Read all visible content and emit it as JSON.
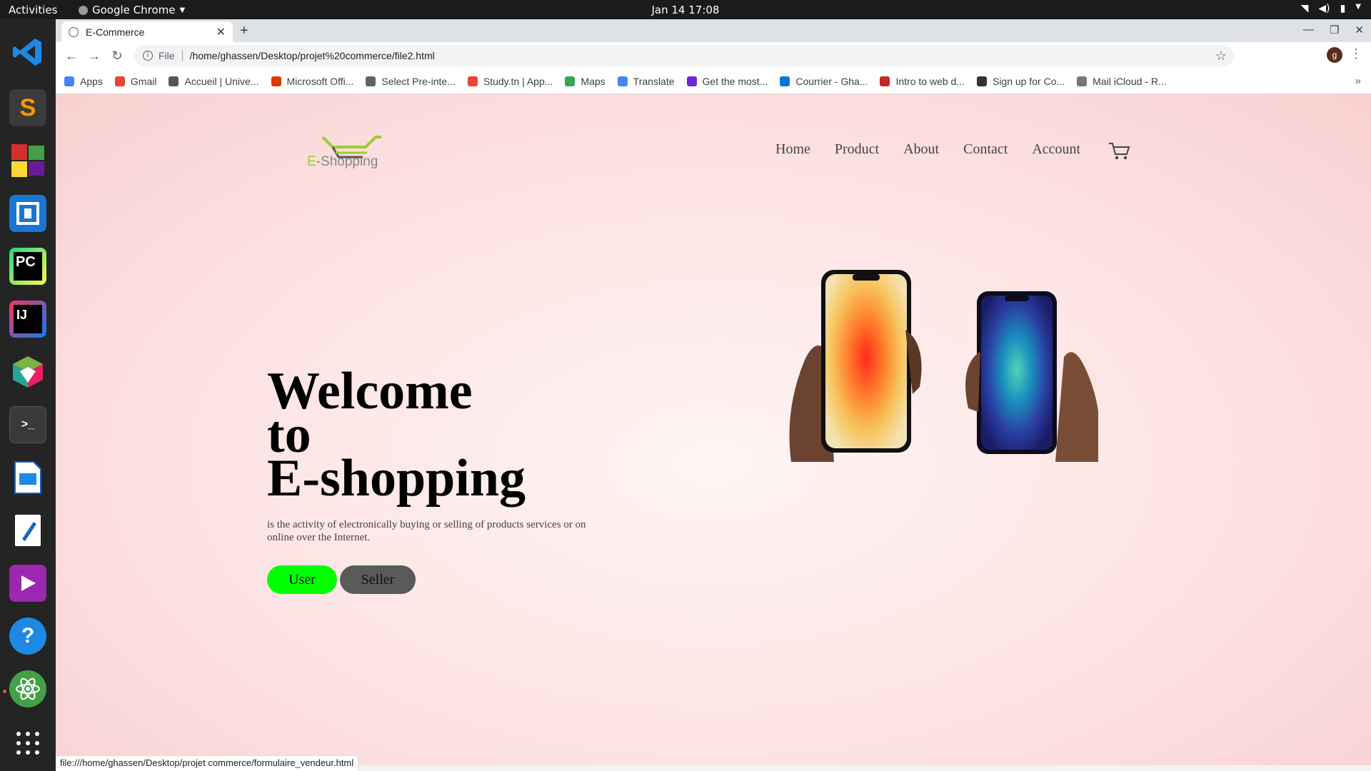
{
  "system": {
    "activities": "Activities",
    "app_name": "Google Chrome",
    "clock": "Jan 14  17:08"
  },
  "browser": {
    "tab_title": "E-Commerce",
    "url_scheme": "File",
    "url": "/home/ghassen/Desktop/projet%20commerce/file2.html",
    "profile_initial": "g",
    "bookmarks": [
      {
        "label": "Apps",
        "color": "#4285f4"
      },
      {
        "label": "Gmail",
        "color": "#ea4335"
      },
      {
        "label": "Accueil | Unive...",
        "color": "#555555"
      },
      {
        "label": "Microsoft Offi...",
        "color": "#d83b01"
      },
      {
        "label": "Select Pre-inte...",
        "color": "#5f6368"
      },
      {
        "label": "Study.tn | App...",
        "color": "#ea4335"
      },
      {
        "label": "Maps",
        "color": "#34a853"
      },
      {
        "label": "Translate",
        "color": "#4285f4"
      },
      {
        "label": "Get the most...",
        "color": "#6c2bd9"
      },
      {
        "label": "Courrier - Gha...",
        "color": "#0078d4"
      },
      {
        "label": "Intro to web d...",
        "color": "#c62828"
      },
      {
        "label": "Sign up for Co...",
        "color": "#333333"
      },
      {
        "label": "Mail iCloud - R...",
        "color": "#777777"
      }
    ],
    "bookmarks_overflow": "»",
    "status_url": "file:///home/ghassen/Desktop/projet commerce/formulaire_vendeur.html"
  },
  "page": {
    "logo_text_e": "E",
    "logo_text_rest": "-Shopping",
    "nav": [
      "Home",
      "Product",
      "About",
      "Contact",
      "Account"
    ],
    "hero_line1": "Welcome",
    "hero_line2": "to",
    "hero_line3": "E-shopping",
    "description": "is the activity of electronically buying or selling of products services or on online over the Internet.",
    "user_button": "User",
    "seller_button": "Seller"
  },
  "colors": {
    "user_button": "#00ff00",
    "seller_button": "#5a5a5a",
    "page_background": "#fde3e3"
  }
}
